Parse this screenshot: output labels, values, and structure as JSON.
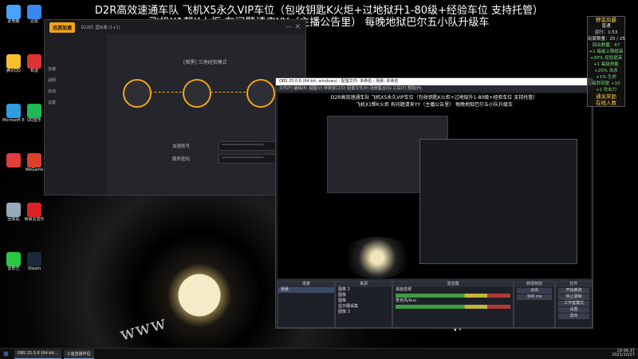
{
  "overlay": {
    "line1": "D2R高效速通车队 飞机X5永久VIP车位（包收钥匙K火炬+过地狱升1-80级+经验车位 支持托管）",
    "line2": "飞机X1帮K火炬   有问题请来YY（主播公告里）  每晚地狱巴尔五小队升级车"
  },
  "desktop_icons": [
    {
      "label": "此电脑",
      "color": "#4aa3ff"
    },
    {
      "label": "腾讯QQ",
      "color": "#f9c12e"
    },
    {
      "label": "Microsoft Edge",
      "color": "#2f9de0"
    },
    {
      "label": "",
      "color": "#e23c3c"
    },
    {
      "label": "回收站",
      "color": "#9ab"
    },
    {
      "label": "爱奇艺",
      "color": "#28c940"
    },
    {
      "label": "迅雷",
      "color": "#3a87f0"
    },
    {
      "label": "有道",
      "color": "#d33"
    },
    {
      "label": "QQ音乐",
      "color": "#1db954"
    },
    {
      "label": "WeGame",
      "color": "#d9412b"
    },
    {
      "label": "网易云音乐",
      "color": "#d22"
    },
    {
      "label": "Steam",
      "color": "#1b2838"
    }
  ],
  "app": {
    "logo": "迅游加速",
    "header": "【D2R】国际服 (1+1)",
    "mode_label": "[暗黑] 三地经验模式",
    "account_label": "加速账号",
    "password_label": "服务密码",
    "account_placeholder": "*********************",
    "password_placeholder": "*********************",
    "sidebar": [
      "加速",
      "战网",
      "启动",
      "设置"
    ]
  },
  "obs": {
    "title": "OBS 25.0.8 (64-bit, windows) - 配置文件: 未命名 - 场景: 未命名",
    "menu": "文件(F)  编辑(E)  视图(V)  停靠窗口(D)  配置文件(P)  场景集合(S)  工具(T)  帮助(H)",
    "docks": {
      "scenes": "场景",
      "sources": "来源",
      "mixer": "混音器",
      "transitions": "转场特效",
      "controls": "控件"
    },
    "scene_list": [
      "场景"
    ],
    "source_list": [
      "图像 2",
      "图像",
      "图像",
      "显示器采集",
      "图像 3"
    ],
    "mixer_items": [
      "桌面音频",
      "麦克风/Aux"
    ],
    "transition": "淡出",
    "duration": "300 ms",
    "controls": [
      "开始推流",
      "停止录制",
      "工作室模式",
      "设置",
      "退出"
    ]
  },
  "panel": {
    "title": "野蛮风暴",
    "mode": "普通",
    "lines": [
      "运行：1:53",
      "玩家数量：25 / 25",
      "回合数量：67",
      "+2 每级上限提高",
      "+20% 经验提高",
      "+1 每级技能",
      "+20% 击杀",
      "+1% 生命",
      "每秒回复 +10",
      "+1 攻击力"
    ],
    "rest": [
      "通关奖励",
      "在线人数"
    ]
  },
  "taskbar": {
    "items": [
      "OBS 25.0.8 (64-bit...",
      "斗鱼直播伴侣"
    ],
    "time": "19:06:37",
    "date": "2021/10/27"
  },
  "colors": {
    "accent": "#f3a21a",
    "obs_bg": "#1d1f26",
    "desktop_bg": "#000000"
  }
}
